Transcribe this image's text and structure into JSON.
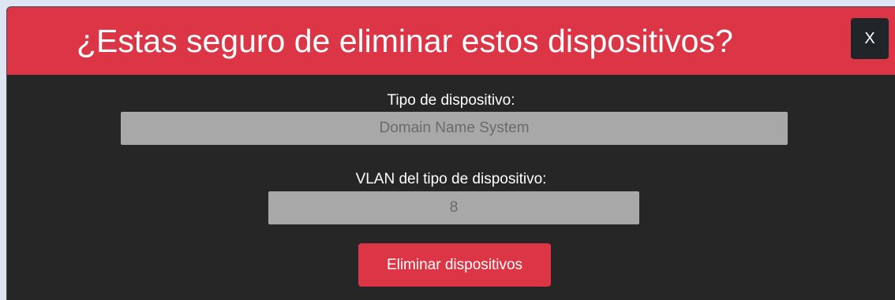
{
  "modal": {
    "title": "¿Estas seguro de eliminar estos dispositivos?",
    "close_label": "X",
    "device_type_label": "Tipo de dispositivo:",
    "device_type_value": "Domain Name System",
    "vlan_label": "VLAN del tipo de dispositivo:",
    "vlan_value": "8",
    "delete_label": "Eliminar dispositivos"
  },
  "colors": {
    "header": "#dc3545",
    "body": "#262626",
    "close_button": "#212529",
    "input_bg": "#a8a8a8",
    "backdrop": "#dce6f2"
  }
}
